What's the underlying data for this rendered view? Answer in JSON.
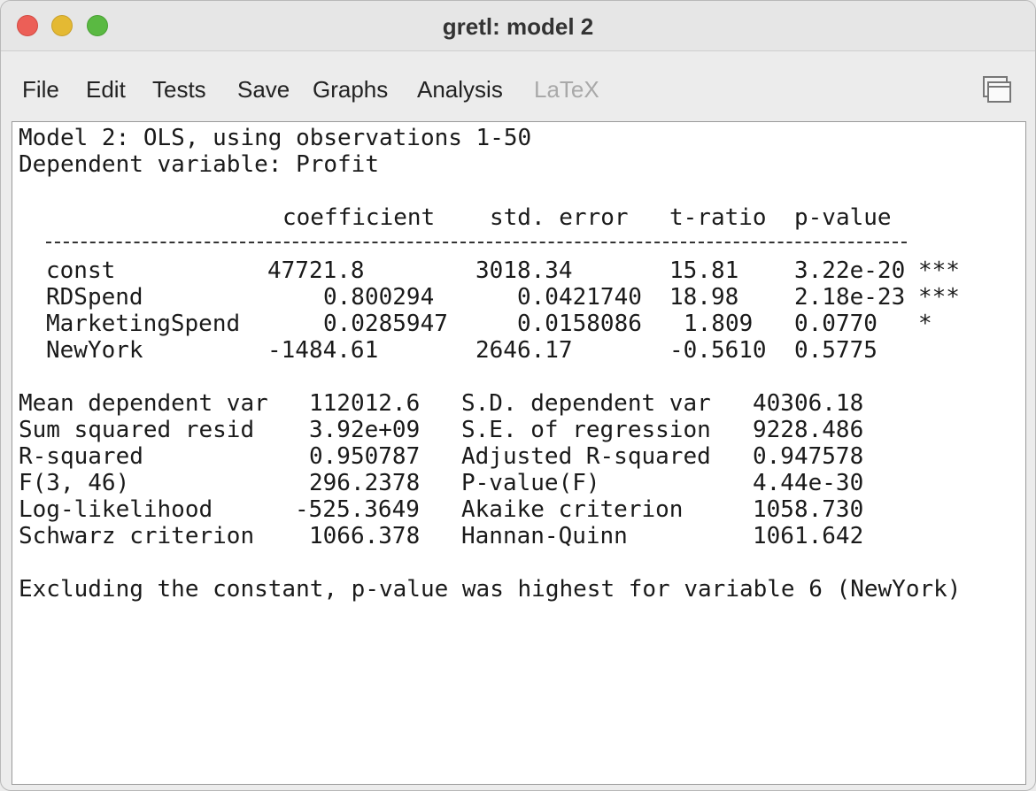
{
  "window": {
    "title": "gretl: model 2"
  },
  "menu": [
    {
      "label": "File",
      "enabled": true
    },
    {
      "label": "Edit",
      "enabled": true
    },
    {
      "label": "Tests",
      "enabled": true
    },
    {
      "label": "Save",
      "enabled": true
    },
    {
      "label": "Graphs",
      "enabled": true
    },
    {
      "label": "Analysis",
      "enabled": true
    },
    {
      "label": "LaTeX",
      "enabled": false
    }
  ],
  "output": {
    "header_line1": "Model 2: OLS, using observations 1-50",
    "header_line2": "Dependent variable: Profit",
    "columns": {
      "coefficient": "coefficient",
      "std_error": "std. error",
      "t_ratio": "t-ratio",
      "p_value": "p-value"
    },
    "rows": [
      {
        "var": "const",
        "coef": "47721.8",
        "se": "3018.34",
        "t": "15.81",
        "p": "3.22e-20",
        "stars": "***"
      },
      {
        "var": "RDSpend",
        "coef": "0.800294",
        "se": "0.0421740",
        "t": "18.98",
        "p": "2.18e-23",
        "stars": "***"
      },
      {
        "var": "MarketingSpend",
        "coef": "0.0285947",
        "se": "0.0158086",
        "t": "1.809",
        "p": "0.0770",
        "stars": "*"
      },
      {
        "var": "NewYork",
        "coef": "-1484.61",
        "se": "2646.17",
        "t": "-0.5610",
        "p": "0.5775",
        "stars": ""
      }
    ],
    "stats": [
      {
        "l_label": "Mean dependent var",
        "l_value": "112012.6",
        "r_label": "S.D. dependent var",
        "r_value": "40306.18"
      },
      {
        "l_label": "Sum squared resid",
        "l_value": "3.92e+09",
        "r_label": "S.E. of regression",
        "r_value": "9228.486"
      },
      {
        "l_label": "R-squared",
        "l_value": "0.950787",
        "r_label": "Adjusted R-squared",
        "r_value": "0.947578"
      },
      {
        "l_label": "F(3, 46)",
        "l_value": "296.2378",
        "r_label": "P-value(F)",
        "r_value": "4.44e-30"
      },
      {
        "l_label": "Log-likelihood",
        "l_value": "-525.3649",
        "r_label": "Akaike criterion",
        "r_value": "1058.730"
      },
      {
        "l_label": "Schwarz criterion",
        "l_value": "1066.378",
        "r_label": "Hannan-Quinn",
        "r_value": "1061.642"
      }
    ],
    "footer": "Excluding the constant, p-value was highest for variable 6 (NewYork)"
  }
}
